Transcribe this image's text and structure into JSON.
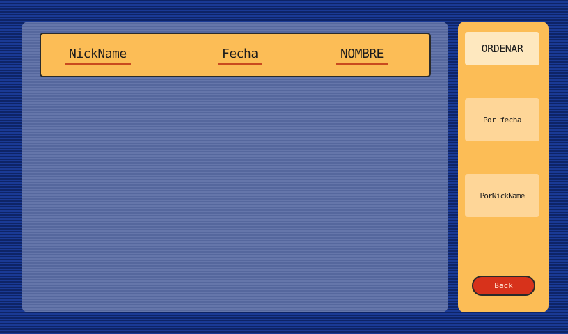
{
  "table": {
    "columns": {
      "nickname": "NickName",
      "fecha": "Fecha",
      "nombre": "NOMBRE"
    },
    "rows": []
  },
  "sidebar": {
    "title": "ORDENAR",
    "sort_by_date": "Por fecha",
    "sort_by_nickname": "PorNickName",
    "back": "Back"
  },
  "colors": {
    "background": "#0f2a7a",
    "list_panel": "#5b6ea3",
    "accent": "#fcbd56",
    "button_light": "#fed698",
    "back_button": "#d7321b",
    "underline": "#c94a1f"
  }
}
